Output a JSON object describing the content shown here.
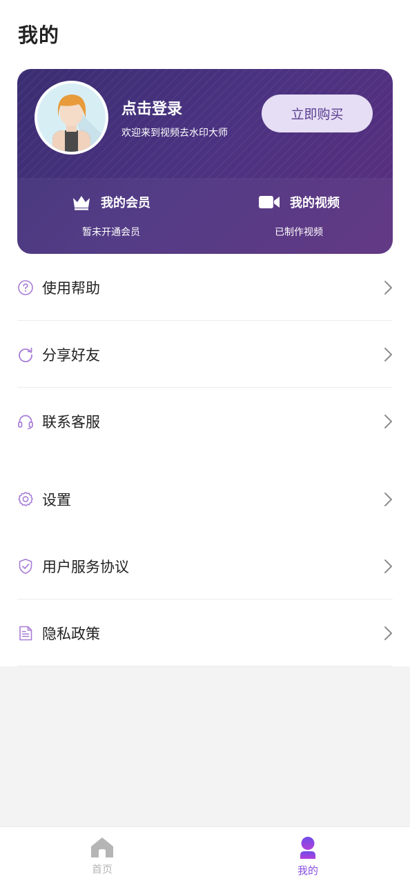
{
  "header": {
    "title": "我的"
  },
  "profile": {
    "login_title": "点击登录",
    "welcome": "欢迎来到视频去水印大师",
    "buy_label": "立即购买",
    "stats": [
      {
        "label": "我的会员",
        "sub": "暂未开通会员",
        "icon": "crown-icon"
      },
      {
        "label": "我的视频",
        "sub": "已制作视频",
        "icon": "video-camera-icon"
      }
    ]
  },
  "menu_group_1": [
    {
      "label": "使用帮助",
      "icon": "help-circle-icon"
    },
    {
      "label": "分享好友",
      "icon": "share-refresh-icon"
    },
    {
      "label": "联系客服",
      "icon": "headset-icon"
    }
  ],
  "menu_group_2": [
    {
      "label": "设置",
      "icon": "gear-icon"
    },
    {
      "label": "用户服务协议",
      "icon": "shield-check-icon"
    },
    {
      "label": "隐私政策",
      "icon": "document-icon"
    }
  ],
  "bottom_nav": [
    {
      "label": "首页",
      "icon": "home-icon",
      "active": false
    },
    {
      "label": "我的",
      "icon": "user-icon",
      "active": true
    }
  ],
  "colors": {
    "accent": "#8a4fe0",
    "card_start": "#3a2d72",
    "card_end": "#5b2f7e",
    "icon_tint": "#a77cd6",
    "inactive": "#b5b5b5"
  }
}
